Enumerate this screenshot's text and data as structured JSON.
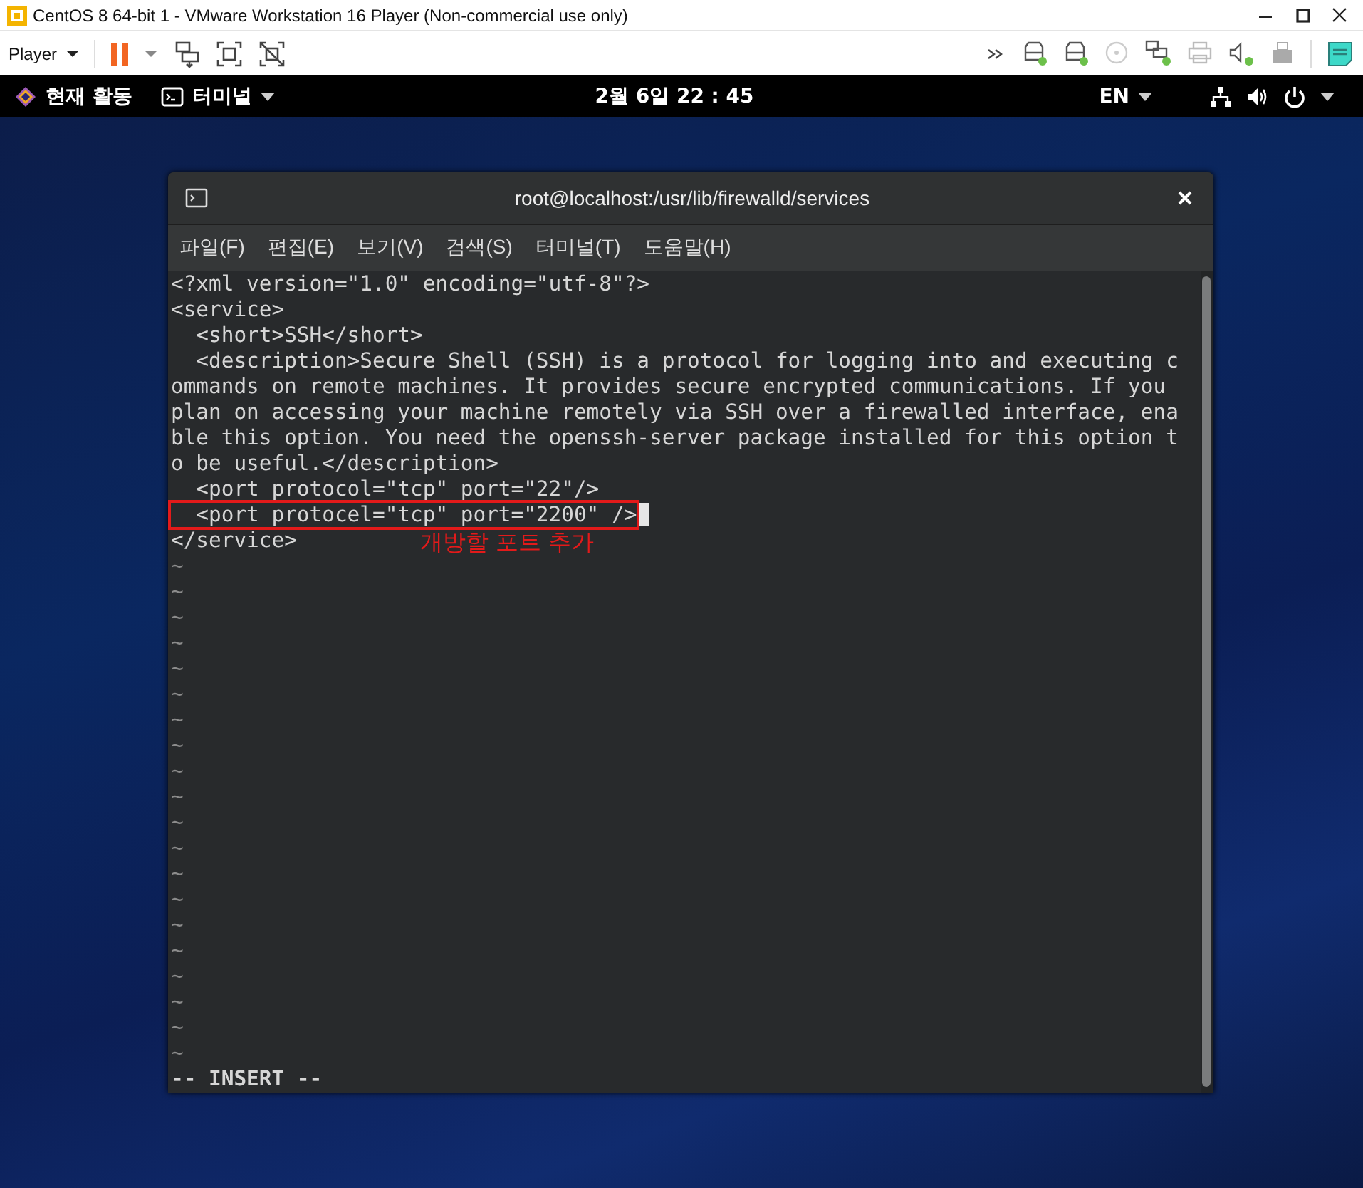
{
  "vm_window": {
    "title": "CentOS 8 64-bit 1 - VMware Workstation 16 Player (Non-commercial use only)"
  },
  "vm_toolbar": {
    "menu": "Player"
  },
  "top_bar": {
    "activities": "현재 활동",
    "app_menu": "터미널",
    "clock": "2월 6일  22 : 45",
    "language": "EN"
  },
  "terminal": {
    "title": "root@localhost:/usr/lib/firewalld/services",
    "menu": [
      "파일(F)",
      "편집(E)",
      "보기(V)",
      "검색(S)",
      "터미널(T)",
      "도움말(H)"
    ],
    "lines": [
      {
        "text": "<?xml version=\"1.0\" encoding=\"utf-8\"?>",
        "highlighted": false,
        "cursor": false
      },
      {
        "text": "<service>",
        "highlighted": false,
        "cursor": false
      },
      {
        "text": "  <short>SSH</short>",
        "highlighted": false,
        "cursor": false
      },
      {
        "text": "  <description>Secure Shell (SSH) is a protocol for logging into and executing c",
        "highlighted": false,
        "cursor": false
      },
      {
        "text": "ommands on remote machines. It provides secure encrypted communications. If you",
        "highlighted": false,
        "cursor": false
      },
      {
        "text": "plan on accessing your machine remotely via SSH over a firewalled interface, ena",
        "highlighted": false,
        "cursor": false
      },
      {
        "text": "ble this option. You need the openssh-server package installed for this option t",
        "highlighted": false,
        "cursor": false
      },
      {
        "text": "o be useful.</description>",
        "highlighted": false,
        "cursor": false
      },
      {
        "text": "  <port protocol=\"tcp\" port=\"22\"/>",
        "highlighted": false,
        "cursor": false
      },
      {
        "text": "  <port protocel=\"tcp\" port=\"2200\" />",
        "highlighted": true,
        "cursor": true,
        "note": "개방할 포트 추가"
      },
      {
        "text": "</service>",
        "highlighted": false,
        "cursor": false
      }
    ],
    "empty_lines": [
      "~",
      "~",
      "~",
      "~",
      "~",
      "~",
      "~",
      "~",
      "~",
      "~",
      "~",
      "~",
      "~",
      "~",
      "~",
      "~",
      "~",
      "~",
      "~",
      "~"
    ],
    "status": "-- INSERT --"
  }
}
